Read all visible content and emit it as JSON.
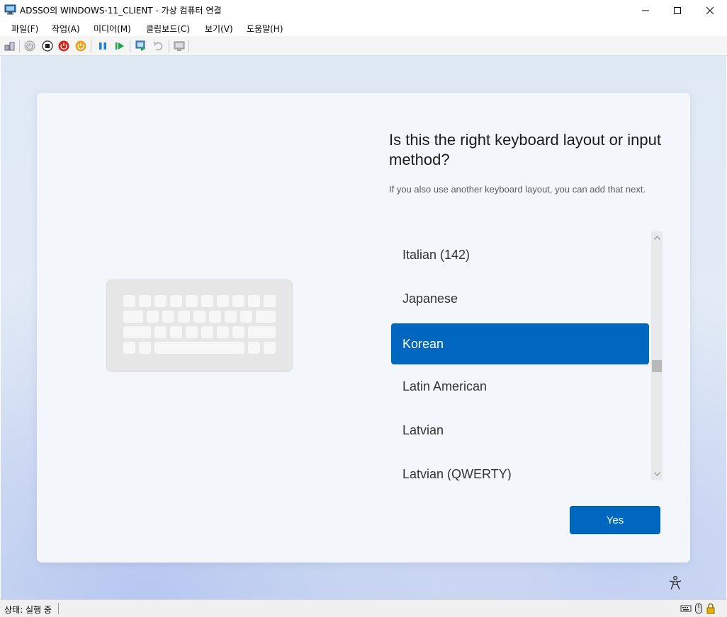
{
  "window": {
    "title": "ADSSO의 WINDOWS-11_CLIENT - 가상 컴퓨터 연결",
    "app_icon": "vm-connect-icon"
  },
  "menu": [
    {
      "label": "파일(F)"
    },
    {
      "label": "작업(A)"
    },
    {
      "label": "미디어(M)"
    },
    {
      "label": "클립보드(C)"
    },
    {
      "label": "보기(V)"
    },
    {
      "label": "도움말(H)"
    }
  ],
  "toolbar": {
    "icons": [
      "ctrl-alt-del-icon",
      "start-icon",
      "turn-off-icon",
      "shutdown-icon",
      "save-icon",
      "pause-icon",
      "resume-icon",
      "checkpoint-icon",
      "revert-icon",
      "enhanced-session-icon"
    ]
  },
  "setup": {
    "heading": "Is this the right keyboard layout or input method?",
    "subtext": "If you also use another keyboard layout, you can add that next.",
    "layouts": [
      {
        "label": "Italian (142)",
        "selected": false
      },
      {
        "label": "Japanese",
        "selected": false
      },
      {
        "label": "Korean",
        "selected": true
      },
      {
        "label": "Latin American",
        "selected": false
      },
      {
        "label": "Latvian",
        "selected": false
      },
      {
        "label": "Latvian (QWERTY)",
        "selected": false
      }
    ],
    "yes_label": "Yes",
    "accent_color": "#0067c0"
  },
  "status": {
    "text": "상태: 실행 중"
  }
}
